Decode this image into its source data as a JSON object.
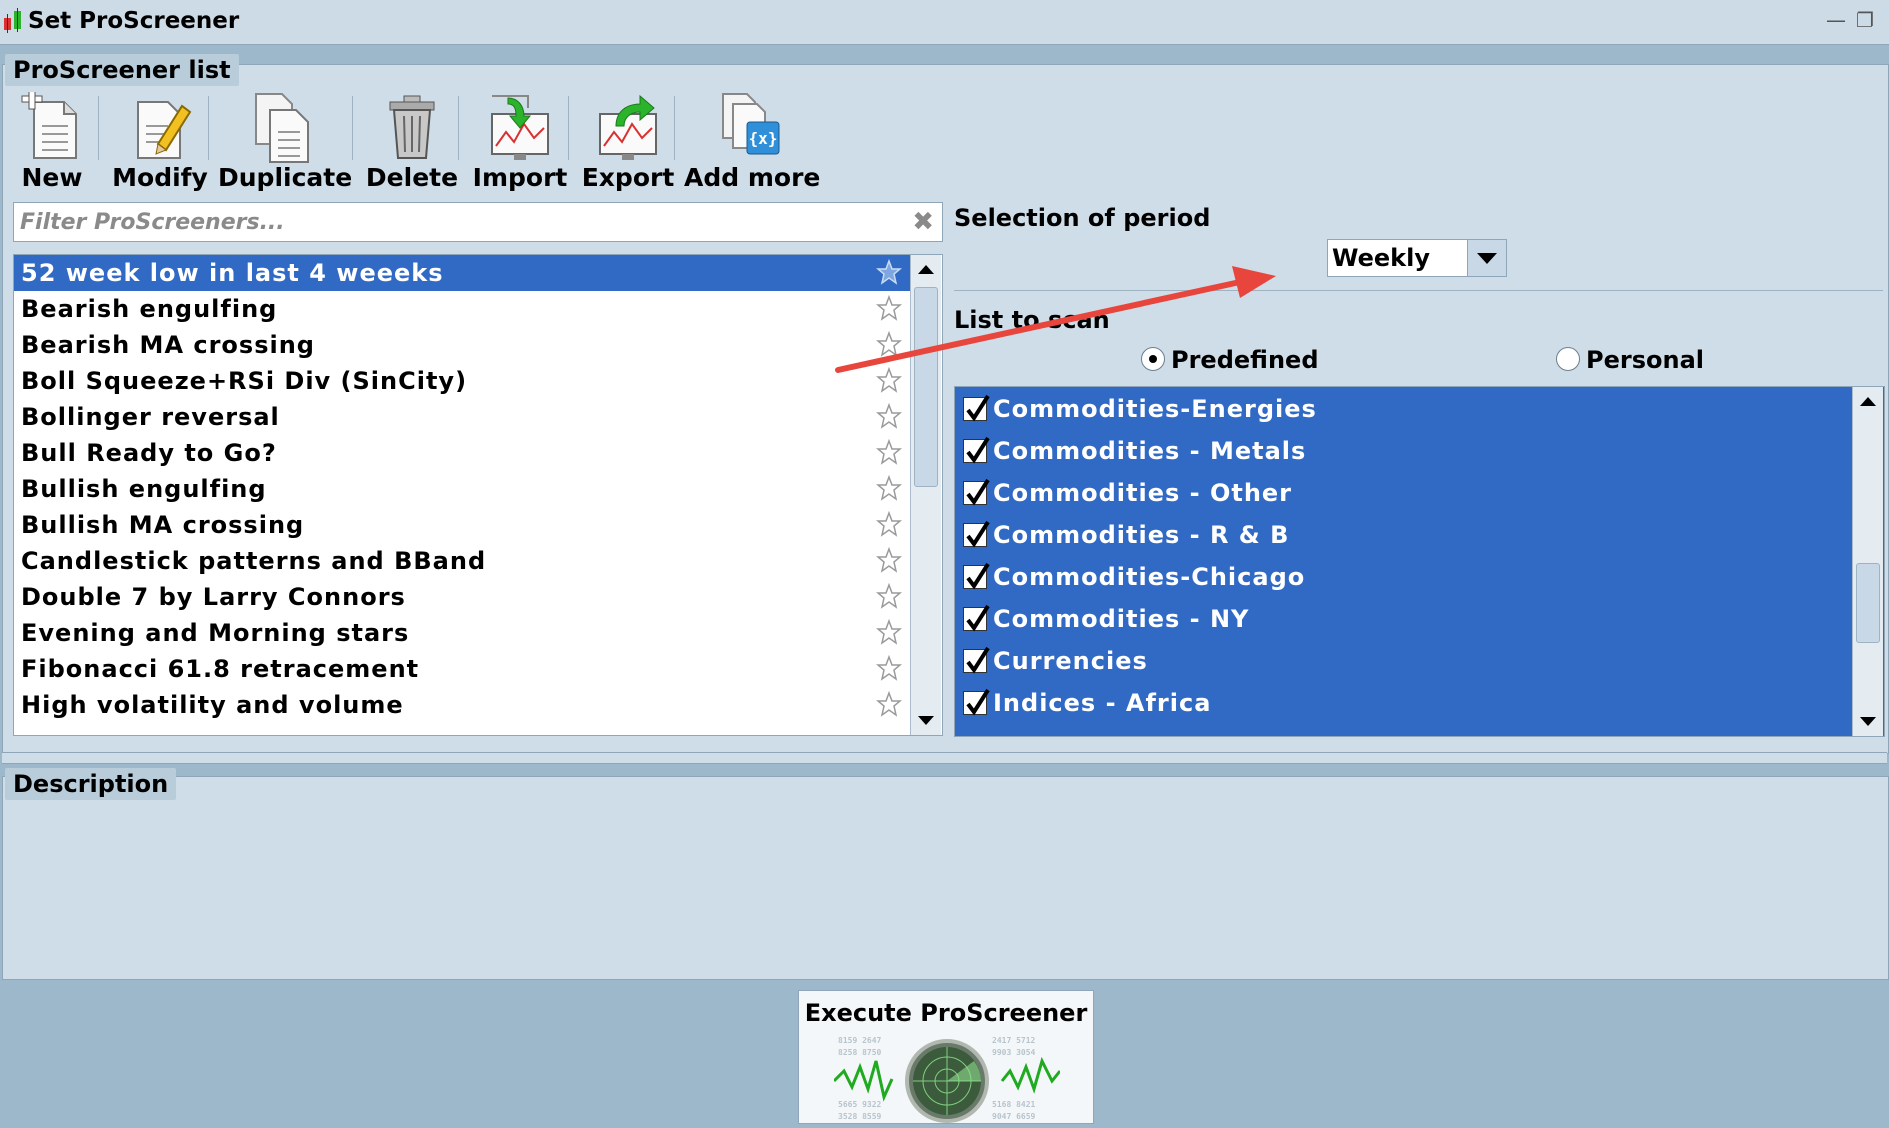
{
  "window": {
    "title": "Set ProScreener"
  },
  "list_panel": {
    "label": "ProScreener list",
    "toolbar": [
      {
        "name": "new",
        "label": "New"
      },
      {
        "name": "modify",
        "label": "Modify"
      },
      {
        "name": "duplicate",
        "label": "Duplicate"
      },
      {
        "name": "delete",
        "label": "Delete"
      },
      {
        "name": "import",
        "label": "Import"
      },
      {
        "name": "export",
        "label": "Export"
      },
      {
        "name": "add-more",
        "label": "Add more"
      }
    ],
    "filter": {
      "placeholder": "Filter ProScreeners..."
    },
    "screeners": [
      "52 week low in last 4 weeeks",
      "Bearish engulfing",
      "Bearish MA crossing",
      "Boll Squeeze+RSi Div (SinCity)",
      "Bollinger reversal",
      "Bull Ready to Go?",
      "Bullish engulfing",
      "Bullish MA crossing",
      "Candlestick patterns and BBand",
      "Double 7 by Larry Connors",
      "Evening and Morning stars",
      "Fibonacci 61.8 retracement",
      "High volatility and volume"
    ],
    "selected_index": 0
  },
  "period": {
    "label": "Selection of period",
    "selected": "Weekly"
  },
  "scan": {
    "label": "List to scan",
    "options": [
      "Predefined",
      "Personal"
    ],
    "selected": "Predefined",
    "markets": [
      "Commodities-Energies",
      "Commodities - Metals",
      "Commodities - Other",
      "Commodities - R & B",
      "Commodities-Chicago",
      "Commodities - NY",
      "Currencies",
      "Indices - Africa"
    ]
  },
  "description": {
    "label": "Description"
  },
  "execute": {
    "label": "Execute ProScreener"
  },
  "colors": {
    "selection": "#316ac5",
    "panel": "#cfdde8",
    "annotation_arrow": "#e8453c"
  }
}
